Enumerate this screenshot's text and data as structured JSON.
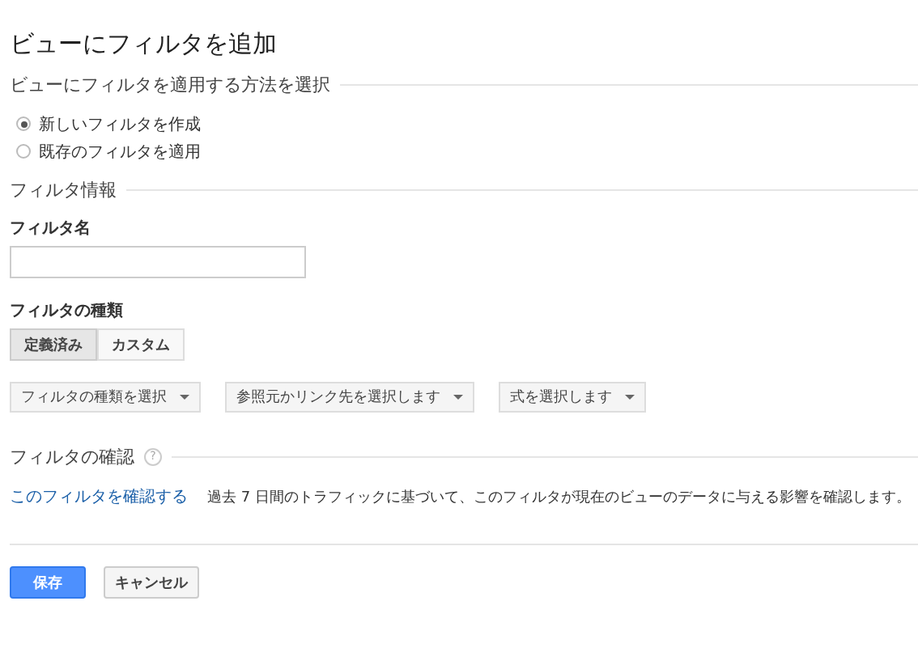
{
  "title": "ビューにフィルタを追加",
  "method_section": {
    "heading": "ビューにフィルタを適用する方法を選択",
    "options": [
      {
        "label": "新しいフィルタを作成",
        "selected": true
      },
      {
        "label": "既存のフィルタを適用",
        "selected": false
      }
    ]
  },
  "info_section": {
    "heading": "フィルタ情報",
    "name_label": "フィルタ名",
    "type_label": "フィルタの種類",
    "type_tabs": [
      {
        "label": "定義済み",
        "selected": true
      },
      {
        "label": "カスタム",
        "selected": false
      }
    ],
    "dropdowns": [
      "フィルタの種類を選択",
      "参照元かリンク先を選択します",
      "式を選択します"
    ]
  },
  "verify_section": {
    "heading": "フィルタの確認",
    "help": "?",
    "link": "このフィルタを確認する",
    "description": "過去 7 日間のトラフィックに基づいて、このフィルタが現在のビューのデータに与える影響を確認します。"
  },
  "buttons": {
    "save": "保存",
    "cancel": "キャンセル"
  }
}
